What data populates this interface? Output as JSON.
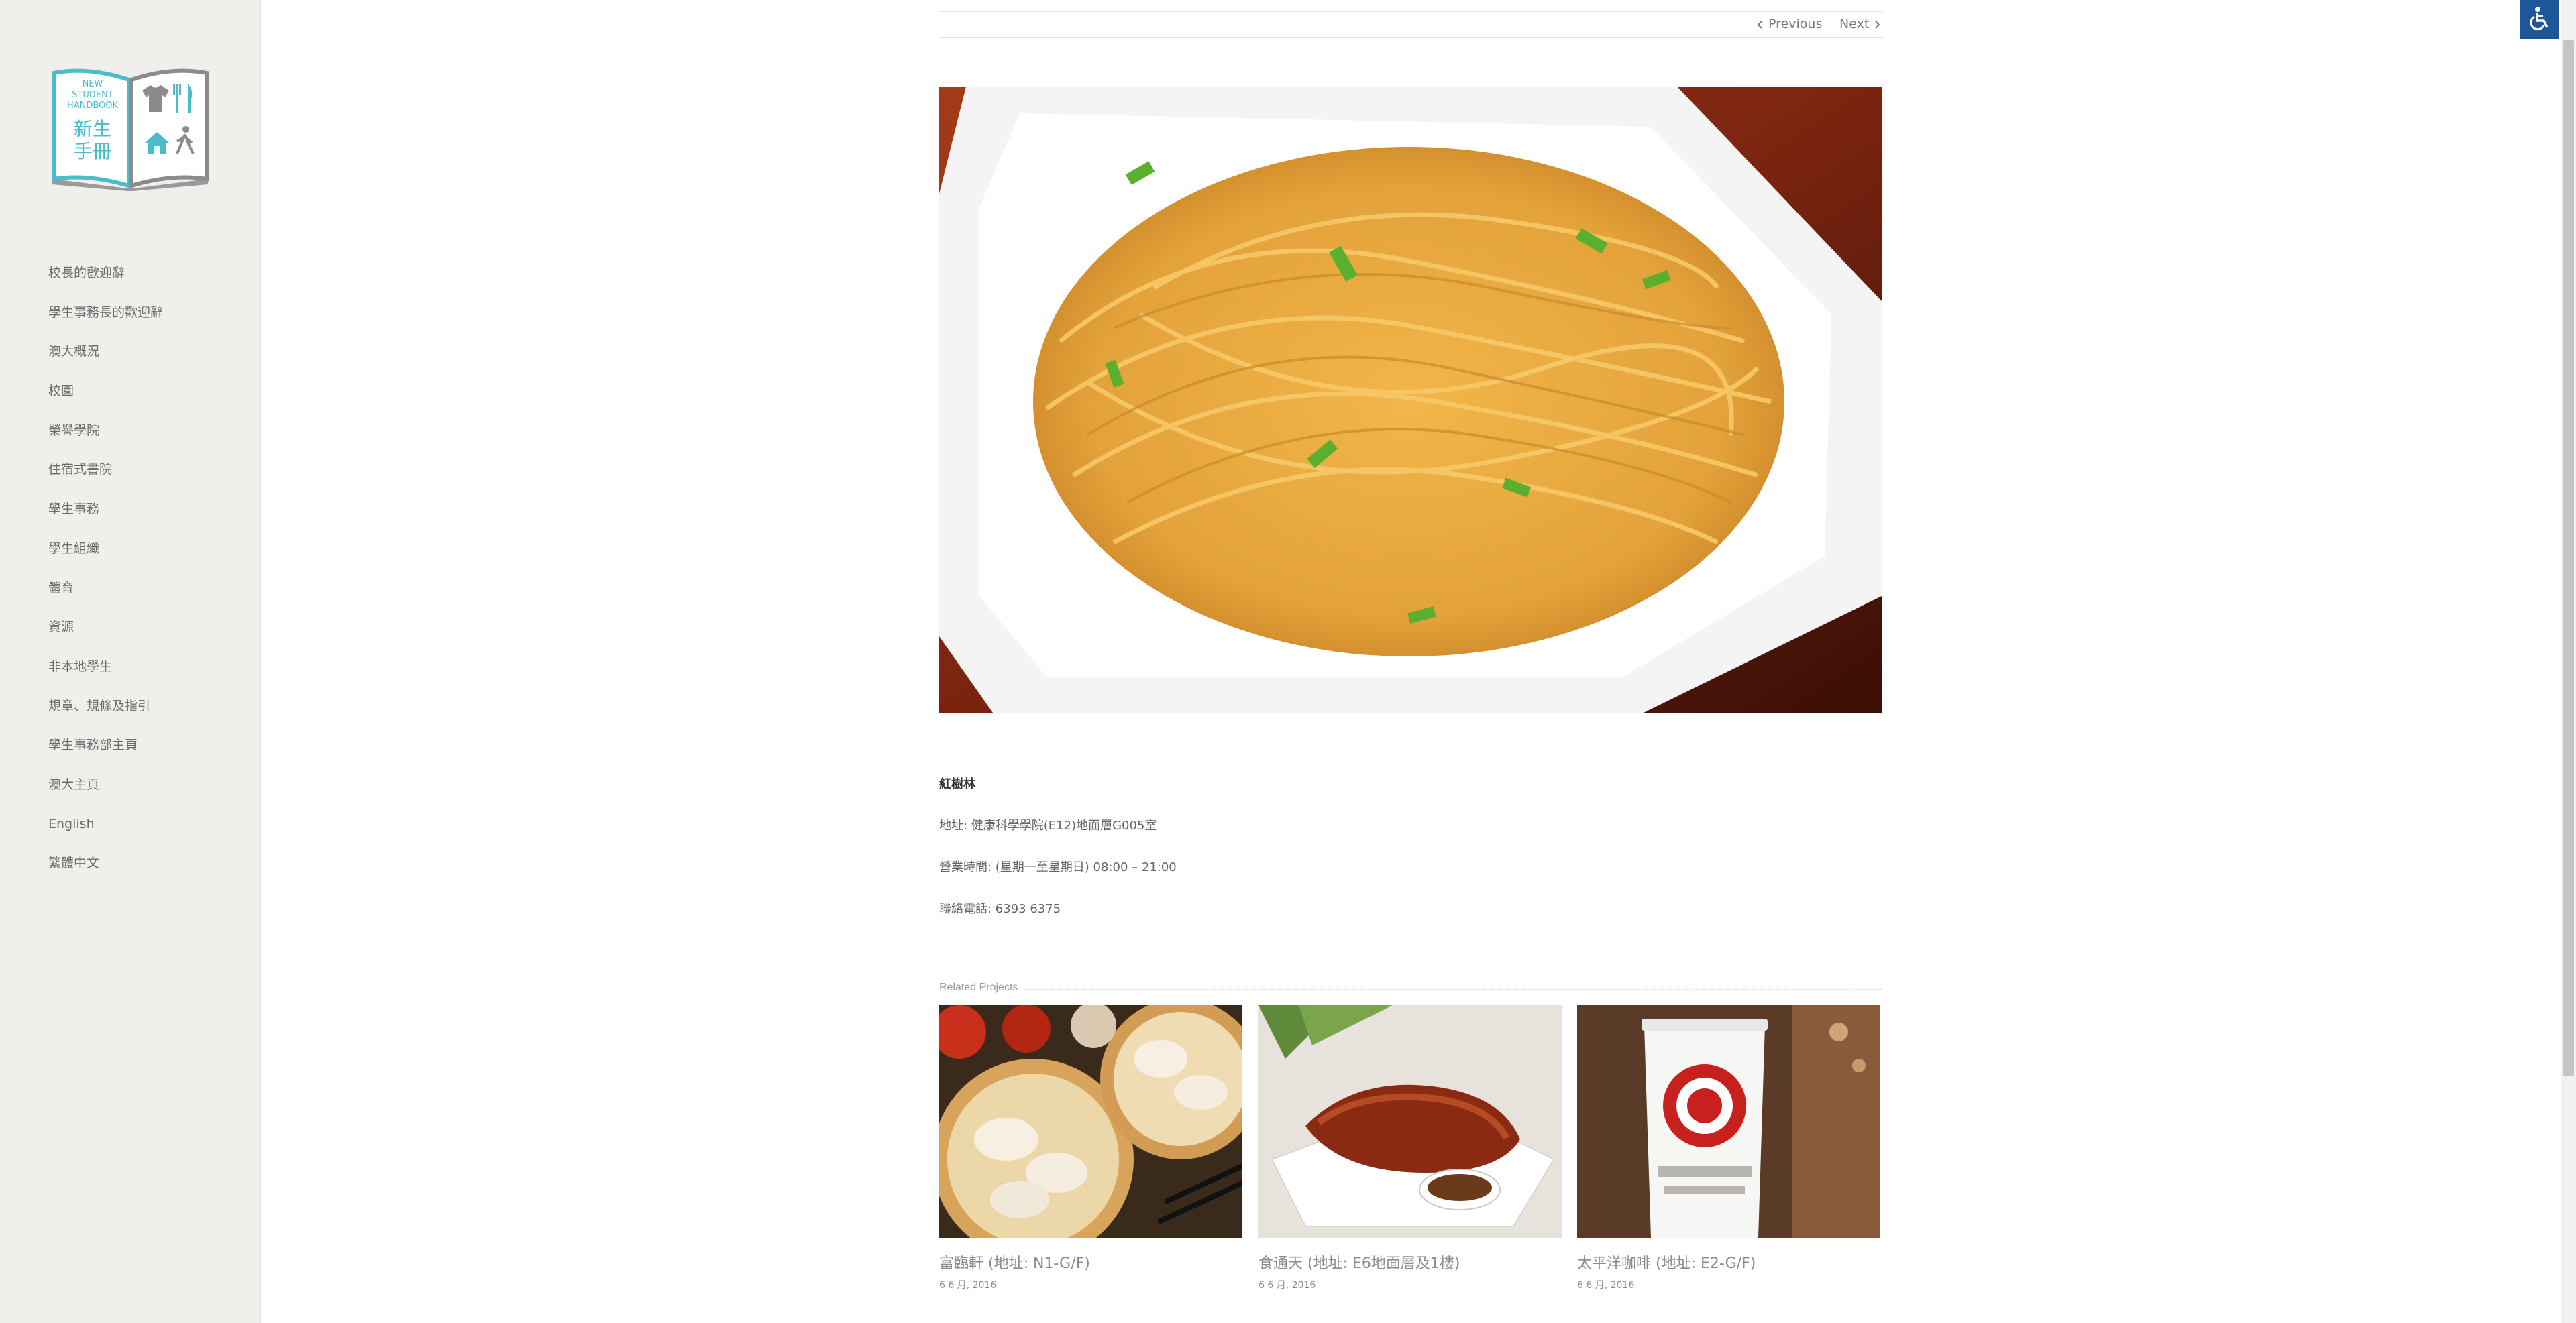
{
  "logo": {
    "english_lines": [
      "NEW",
      "STUDENT",
      "HANDBOOK"
    ],
    "chinese_lines": [
      "新生",
      "手冊"
    ]
  },
  "sidebar": {
    "items": [
      {
        "label": "校長的歡迎辭"
      },
      {
        "label": "學生事務長的歡迎辭"
      },
      {
        "label": "澳大概況"
      },
      {
        "label": "校園"
      },
      {
        "label": "榮譽學院"
      },
      {
        "label": "住宿式書院"
      },
      {
        "label": "學生事務"
      },
      {
        "label": "學生組織"
      },
      {
        "label": "體育"
      },
      {
        "label": "資源"
      },
      {
        "label": "非本地學生"
      },
      {
        "label": "規章、規條及指引"
      },
      {
        "label": "學生事務部主頁"
      },
      {
        "label": "澳大主頁"
      },
      {
        "label": "English"
      },
      {
        "label": "繁體中文"
      }
    ]
  },
  "pager": {
    "previous_label": "Previous",
    "next_label": "Next"
  },
  "project": {
    "title": "紅樹林",
    "address": "地址: 健康科學學院(E12)地面層G005室",
    "hours": "營業時間: (星期一至星期日) 08:00 – 21:00",
    "phone": "聯絡電話: 6393 6375"
  },
  "related": {
    "heading": "Related Projects",
    "items": [
      {
        "name": "富臨軒 (地址: N1-G/F)",
        "date": "6 6 月, 2016"
      },
      {
        "name": "食通天 (地址: E6地面層及1樓)",
        "date": "6 6 月, 2016"
      },
      {
        "name": "太平洋咖啡 (地址: E2-G/F)",
        "date": "6 6 月, 2016"
      }
    ]
  },
  "colors": {
    "sidebar_bg": "#f0efec",
    "logo_teal": "#4bbcc9",
    "accessibility_blue": "#1e5799"
  },
  "icons": {
    "accessibility": "wheelchair-icon",
    "previous": "chevron-left-icon",
    "next": "chevron-right-icon"
  }
}
